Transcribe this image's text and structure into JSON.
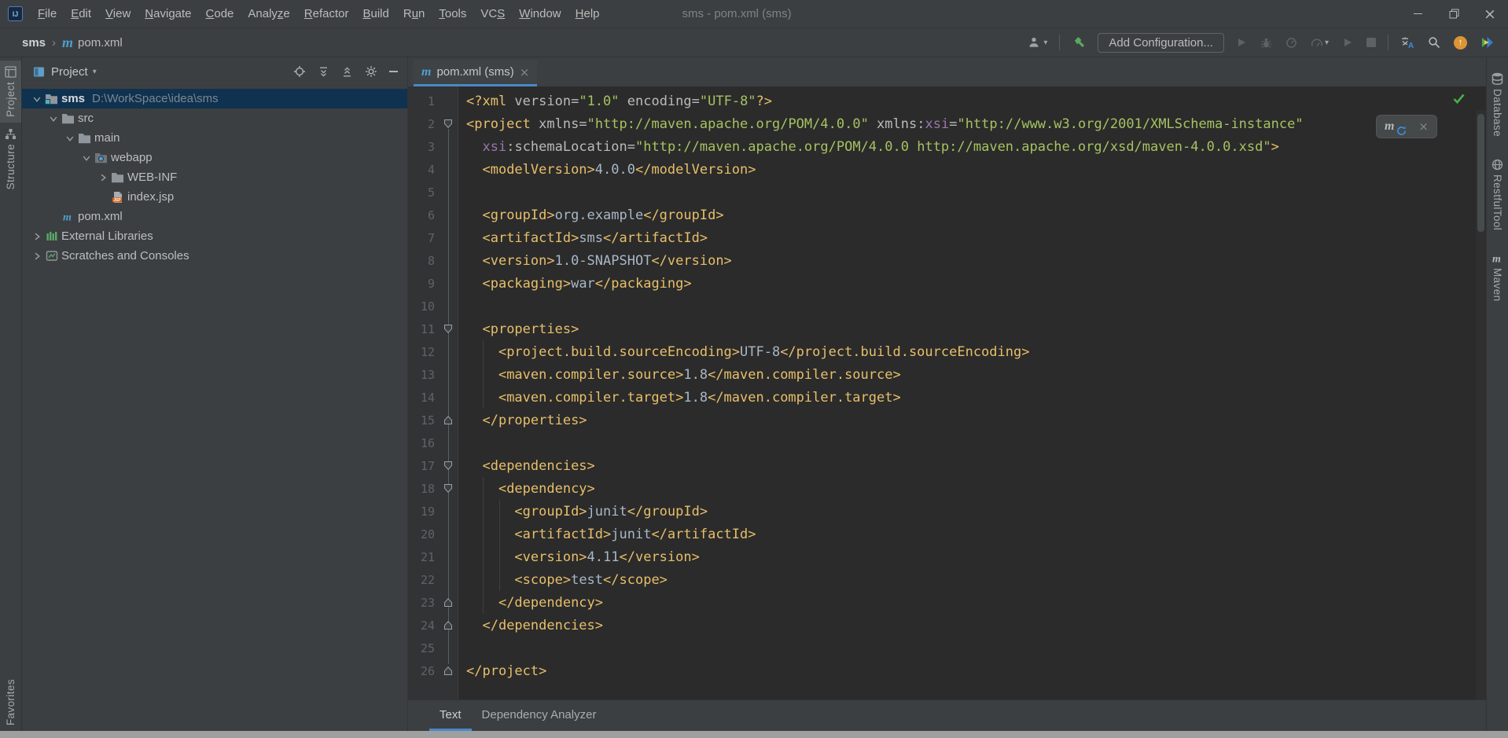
{
  "titlebar": {
    "app_icon": "IJ",
    "menus": [
      {
        "pre": "",
        "mn": "F",
        "post": "ile"
      },
      {
        "pre": "",
        "mn": "E",
        "post": "dit"
      },
      {
        "pre": "",
        "mn": "V",
        "post": "iew"
      },
      {
        "pre": "",
        "mn": "N",
        "post": "avigate"
      },
      {
        "pre": "",
        "mn": "C",
        "post": "ode"
      },
      {
        "pre": "Analy",
        "mn": "z",
        "post": "e"
      },
      {
        "pre": "",
        "mn": "R",
        "post": "efactor"
      },
      {
        "pre": "",
        "mn": "B",
        "post": "uild"
      },
      {
        "pre": "R",
        "mn": "u",
        "post": "n"
      },
      {
        "pre": "",
        "mn": "T",
        "post": "ools"
      },
      {
        "pre": "VC",
        "mn": "S",
        "post": ""
      },
      {
        "pre": "",
        "mn": "W",
        "post": "indow"
      },
      {
        "pre": "",
        "mn": "H",
        "post": "elp"
      }
    ],
    "window_title": "sms - pom.xml (sms)"
  },
  "navbar": {
    "breadcrumbs": [
      "sms",
      "pom.xml"
    ],
    "add_configuration_label": "Add Configuration..."
  },
  "project_panel": {
    "header": {
      "title": "Project"
    },
    "tree": [
      {
        "indent": 0,
        "chevron": "down",
        "icon": "project-folder",
        "label": "sms",
        "path": "D:\\WorkSpace\\idea\\sms",
        "selected": true,
        "bold": true
      },
      {
        "indent": 1,
        "chevron": "down",
        "icon": "folder",
        "label": "src"
      },
      {
        "indent": 2,
        "chevron": "down",
        "icon": "folder",
        "label": "main"
      },
      {
        "indent": 3,
        "chevron": "down",
        "icon": "folder-web",
        "label": "webapp"
      },
      {
        "indent": 4,
        "chevron": "right",
        "icon": "folder",
        "label": "WEB-INF"
      },
      {
        "indent": 4,
        "chevron": "none",
        "icon": "jsp-file",
        "label": "index.jsp"
      },
      {
        "indent": 1,
        "chevron": "none",
        "icon": "maven",
        "label": "pom.xml"
      },
      {
        "indent": 0,
        "chevron": "right",
        "icon": "library",
        "label": "External Libraries"
      },
      {
        "indent": 0,
        "chevron": "right",
        "icon": "scratches",
        "label": "Scratches and Consoles"
      }
    ]
  },
  "editor": {
    "tab": {
      "label": "pom.xml (sms)"
    },
    "lines": [
      {
        "n": 1,
        "fold": null,
        "tokens": [
          [
            "tag",
            "<?xml "
          ],
          [
            "attr",
            "version"
          ],
          [
            "attr",
            "="
          ],
          [
            "val",
            "\"1.0\""
          ],
          [
            "attr",
            " encoding"
          ],
          [
            "attr",
            "="
          ],
          [
            "val",
            "\"UTF-8\""
          ],
          [
            "tag",
            "?>"
          ]
        ]
      },
      {
        "n": 2,
        "fold": "open",
        "tokens": [
          [
            "tag",
            "<project"
          ],
          [
            "plain",
            " "
          ],
          [
            "attr",
            "xmlns"
          ],
          [
            "attr",
            "="
          ],
          [
            "val",
            "\"http://maven.apache.org/POM/4.0.0\""
          ],
          [
            "attr",
            " xmlns"
          ],
          [
            "attr",
            ":"
          ],
          [
            "ns",
            "xsi"
          ],
          [
            "attr",
            "="
          ],
          [
            "val",
            "\"http://www.w3.org/2001/XMLSchema-instance\""
          ]
        ]
      },
      {
        "n": 3,
        "fold": null,
        "tokens": [
          [
            "plain",
            "  "
          ],
          [
            "ns",
            "xsi"
          ],
          [
            "attr",
            ":"
          ],
          [
            "attr",
            "schemaLocation"
          ],
          [
            "attr",
            "="
          ],
          [
            "val",
            "\"http://maven.apache.org/POM/4.0.0 http://maven.apache.org/xsd/maven-4.0.0.xsd\""
          ],
          [
            "tag",
            ">"
          ]
        ]
      },
      {
        "n": 4,
        "fold": null,
        "tokens": [
          [
            "plain",
            "  "
          ],
          [
            "tag",
            "<modelVersion>"
          ],
          [
            "txt",
            "4.0.0"
          ],
          [
            "tag",
            "</modelVersion>"
          ]
        ]
      },
      {
        "n": 5,
        "fold": null,
        "tokens": []
      },
      {
        "n": 6,
        "fold": null,
        "tokens": [
          [
            "plain",
            "  "
          ],
          [
            "tag",
            "<groupId>"
          ],
          [
            "txt",
            "org.example"
          ],
          [
            "tag",
            "</groupId>"
          ]
        ]
      },
      {
        "n": 7,
        "fold": null,
        "tokens": [
          [
            "plain",
            "  "
          ],
          [
            "tag",
            "<artifactId>"
          ],
          [
            "txt",
            "sms"
          ],
          [
            "tag",
            "</artifactId>"
          ]
        ]
      },
      {
        "n": 8,
        "fold": null,
        "tokens": [
          [
            "plain",
            "  "
          ],
          [
            "tag",
            "<version>"
          ],
          [
            "txt",
            "1.0-SNAPSHOT"
          ],
          [
            "tag",
            "</version>"
          ]
        ]
      },
      {
        "n": 9,
        "fold": null,
        "tokens": [
          [
            "plain",
            "  "
          ],
          [
            "tag",
            "<packaging>"
          ],
          [
            "txt",
            "war"
          ],
          [
            "tag",
            "</packaging>"
          ]
        ]
      },
      {
        "n": 10,
        "fold": null,
        "tokens": []
      },
      {
        "n": 11,
        "fold": "open",
        "tokens": [
          [
            "plain",
            "  "
          ],
          [
            "tag",
            "<properties>"
          ]
        ]
      },
      {
        "n": 12,
        "fold": null,
        "tokens": [
          [
            "plain",
            "    "
          ],
          [
            "tag",
            "<project.build.sourceEncoding>"
          ],
          [
            "txt",
            "UTF-8"
          ],
          [
            "tag",
            "</project.build.sourceEncoding>"
          ]
        ]
      },
      {
        "n": 13,
        "fold": null,
        "tokens": [
          [
            "plain",
            "    "
          ],
          [
            "tag",
            "<maven.compiler.source>"
          ],
          [
            "txt",
            "1.8"
          ],
          [
            "tag",
            "</maven.compiler.source>"
          ]
        ]
      },
      {
        "n": 14,
        "fold": null,
        "tokens": [
          [
            "plain",
            "    "
          ],
          [
            "tag",
            "<maven.compiler.target>"
          ],
          [
            "txt",
            "1.8"
          ],
          [
            "tag",
            "</maven.compiler.target>"
          ]
        ]
      },
      {
        "n": 15,
        "fold": "close",
        "tokens": [
          [
            "plain",
            "  "
          ],
          [
            "tag",
            "</properties>"
          ]
        ]
      },
      {
        "n": 16,
        "fold": null,
        "tokens": []
      },
      {
        "n": 17,
        "fold": "open",
        "tokens": [
          [
            "plain",
            "  "
          ],
          [
            "tag",
            "<dependencies>"
          ]
        ]
      },
      {
        "n": 18,
        "fold": "open",
        "tokens": [
          [
            "plain",
            "    "
          ],
          [
            "tag",
            "<dependency>"
          ]
        ]
      },
      {
        "n": 19,
        "fold": null,
        "tokens": [
          [
            "plain",
            "      "
          ],
          [
            "tag",
            "<groupId>"
          ],
          [
            "txt",
            "junit"
          ],
          [
            "tag",
            "</groupId>"
          ]
        ]
      },
      {
        "n": 20,
        "fold": null,
        "tokens": [
          [
            "plain",
            "      "
          ],
          [
            "tag",
            "<artifactId>"
          ],
          [
            "txt",
            "junit"
          ],
          [
            "tag",
            "</artifactId>"
          ]
        ]
      },
      {
        "n": 21,
        "fold": null,
        "tokens": [
          [
            "plain",
            "      "
          ],
          [
            "tag",
            "<version>"
          ],
          [
            "txt",
            "4.11"
          ],
          [
            "tag",
            "</version>"
          ]
        ]
      },
      {
        "n": 22,
        "fold": null,
        "tokens": [
          [
            "plain",
            "      "
          ],
          [
            "tag",
            "<scope>"
          ],
          [
            "txt",
            "test"
          ],
          [
            "tag",
            "</scope>"
          ]
        ]
      },
      {
        "n": 23,
        "fold": "close",
        "tokens": [
          [
            "plain",
            "    "
          ],
          [
            "tag",
            "</dependency>"
          ]
        ]
      },
      {
        "n": 24,
        "fold": "close",
        "tokens": [
          [
            "plain",
            "  "
          ],
          [
            "tag",
            "</dependencies>"
          ]
        ]
      },
      {
        "n": 25,
        "fold": null,
        "tokens": []
      },
      {
        "n": 26,
        "fold": "close",
        "tokens": [
          [
            "tag",
            "</project>"
          ]
        ]
      }
    ],
    "guides": [
      {
        "x": 21,
        "from": 12,
        "to": 14
      },
      {
        "x": 21,
        "from": 18,
        "to": 23
      },
      {
        "x": 42,
        "from": 19,
        "to": 22
      }
    ]
  },
  "bottom_tabs": [
    {
      "label": "Text",
      "active": true
    },
    {
      "label": "Dependency Analyzer",
      "active": false
    }
  ],
  "left_stripe": [
    {
      "label": "Project",
      "icon": "project-tool",
      "active": true
    },
    {
      "label": "Structure",
      "icon": "structure-tool",
      "active": false
    },
    {
      "label": "Favorites",
      "icon": null,
      "active": false,
      "bottom": true
    }
  ],
  "right_stripe": [
    {
      "label": "Database",
      "icon": "database-tool"
    },
    {
      "label": "RestfulTool",
      "icon": "globe-tool"
    },
    {
      "label": "Maven",
      "icon": "maven-tool"
    }
  ],
  "icons": {
    "app-logo": "IJ badge",
    "user": "person silhouette",
    "build": "green hammer",
    "run": "play triangle (disabled)",
    "debug": "bug (disabled)",
    "profile": "profiler dial (disabled)",
    "coverage": "gauge (disabled)",
    "stop": "square (disabled)",
    "translate": "CJK char + blue A",
    "search": "magnifier",
    "update": "orange circle with up arrow",
    "plugin": "multicolor arrow",
    "locate": "crosshair circle",
    "expand-all": "double chevrons down",
    "collapse-all": "double chevrons up",
    "settings": "gear",
    "hide": "minus bar",
    "maven": "italic m",
    "inspection-ok": "green check",
    "fold-open": "pentagon down",
    "fold-close": "pentagon up"
  },
  "colors": {
    "frame_bg": "#3c3f41",
    "editor_bg": "#2b2b2b",
    "gutter_bg": "#313335",
    "selection": "#0f3250",
    "accent_blue": "#4a88c7",
    "maven_blue": "#4e9fd2",
    "xml_tag": "#e8bf6a",
    "xml_attr": "#bababa",
    "xml_value": "#a5c261",
    "xml_ns": "#9876aa",
    "xml_text": "#a9b7c6",
    "line_number": "#606366",
    "check_green": "#43b244",
    "hammer_green": "#5ba75f",
    "update_orange": "#dd9435",
    "library_green": "#59a869"
  }
}
